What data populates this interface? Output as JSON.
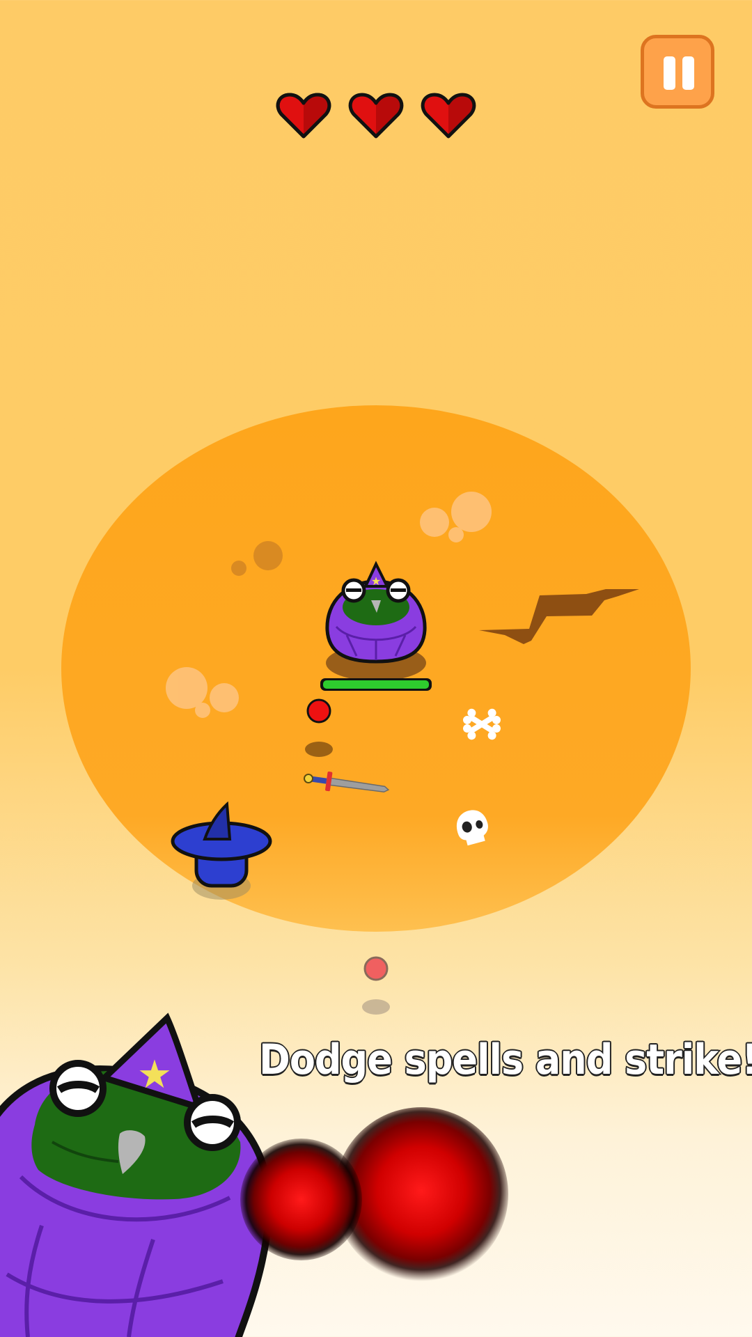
{
  "hud": {
    "lives": 3,
    "max_lives": 3,
    "pause_icon": "pause-icon",
    "heart_icon": "heart-icon"
  },
  "promo": {
    "tagline": "Dodge spells and strike!"
  },
  "boss": {
    "health_fraction": 1.0
  },
  "colors": {
    "sky_top": "#fecc66",
    "sky_bottom": "#fff9ee",
    "arena": "#fea61c",
    "boss_robe": "#8a3de0",
    "boss_face": "#1e6b14",
    "boss_health": "#2ecc2e",
    "player_hat": "#2d3fd0",
    "projectile": "#ee1111",
    "pause_button": "#fea24a",
    "heart": "#e01010"
  }
}
